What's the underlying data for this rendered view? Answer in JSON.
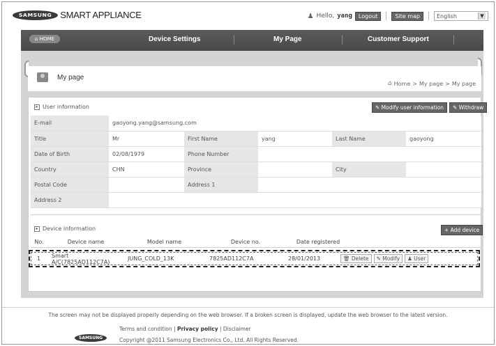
{
  "header": {
    "logo_text": "SAMSUNG",
    "brand": "SMART APPLIANCE",
    "greeting": "Hello,",
    "username": "yang",
    "logout": "Logout",
    "sitemap": "Site map",
    "language": "English"
  },
  "nav": {
    "home": "HOME",
    "items": [
      "Device Settings",
      "My Page",
      "Customer Support"
    ]
  },
  "page": {
    "title": "My page",
    "breadcrumb": [
      "Home",
      ">",
      "My page",
      ">",
      "My page"
    ]
  },
  "user_info": {
    "section_title": "User information",
    "modify_button": "Modify user information",
    "withdraw_button": "Withdraw",
    "labels": {
      "email": "E-mail",
      "title": "Title",
      "first_name": "First Name",
      "last_name": "Last Name",
      "dob": "Date of Birth",
      "phone": "Phone Number",
      "country": "Country",
      "province": "Province",
      "city": "City",
      "postal": "Postal Code",
      "address1": "Address 1",
      "address2": "Address 2"
    },
    "values": {
      "email": "gaoyong.yang@samsung.com",
      "title": "Mr",
      "first_name": "yang",
      "last_name": "gaoyong",
      "dob": "02/08/1979",
      "country": "CHN"
    }
  },
  "device_info": {
    "section_title": "Device information",
    "add_button": "Add device",
    "columns": [
      "No.",
      "Device name",
      "Model name",
      "Device no.",
      "Date registered"
    ],
    "rows": [
      {
        "no": "1",
        "device_name": "Smart A/C(7825AD112C7A)",
        "model_name": "JUNG_COLD_13K",
        "device_no": "7825AD112C7A",
        "date": "28/01/2013",
        "delete": "Delete",
        "modify": "Modify",
        "user": "User"
      }
    ]
  },
  "footer": {
    "notice": "The screen may not be displayed properly depending on the web browser. If a broken screen is displayed, update the web browser to the latest version.",
    "links": [
      "Terms and condition",
      "Privacy policy",
      "Disclaimer"
    ],
    "logo_text": "SAMSUNG",
    "copyright": "Copyright @2011 Samsung Electronics Co., Ltd. All Rights Reserved."
  }
}
